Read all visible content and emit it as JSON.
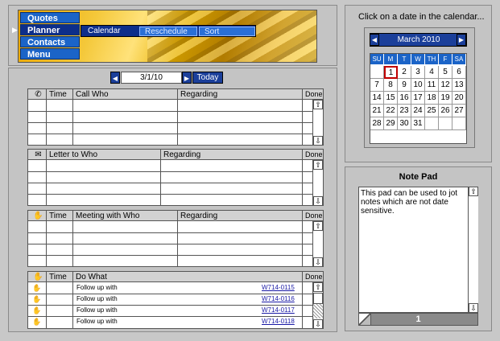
{
  "nav": {
    "items": [
      "Quotes",
      "Planner",
      "Contacts",
      "Menu"
    ],
    "sub_items": [
      "Calendar",
      "Reschedule",
      "Sort"
    ]
  },
  "datebar": {
    "date": "3/1/10",
    "today_label": "Today"
  },
  "calls": {
    "headers": [
      "Time",
      "Call Who",
      "Regarding",
      "Done"
    ]
  },
  "letters": {
    "headers": [
      "Letter to Who",
      "Regarding",
      "Done"
    ]
  },
  "meetings": {
    "headers": [
      "Time",
      "Meeting with Who",
      "Regarding",
      "Done"
    ]
  },
  "todos": {
    "headers": [
      "Time",
      "Do What",
      "Done"
    ],
    "rows": [
      {
        "text": "Follow up with",
        "link": "W714-0115"
      },
      {
        "text": "Follow up with",
        "link": "W714-0116"
      },
      {
        "text": "Follow up with",
        "link": "W714-0117"
      },
      {
        "text": "Follow up with",
        "link": "W714-0118"
      }
    ]
  },
  "calendar": {
    "instruction": "Click on a date in the calendar...",
    "month": "March 2010",
    "days_of_week": [
      "SU",
      "M",
      "T",
      "W",
      "TH",
      "F",
      "SA"
    ],
    "weeks": [
      [
        "",
        "1",
        "2",
        "3",
        "4",
        "5",
        "6"
      ],
      [
        "7",
        "8",
        "9",
        "10",
        "11",
        "12",
        "13"
      ],
      [
        "14",
        "15",
        "16",
        "17",
        "18",
        "19",
        "20"
      ],
      [
        "21",
        "22",
        "23",
        "24",
        "25",
        "26",
        "27"
      ],
      [
        "28",
        "29",
        "30",
        "31",
        "",
        "",
        ""
      ]
    ],
    "selected_day": "1"
  },
  "notepad": {
    "title": "Note Pad",
    "text": "This pad can be used to jot notes which are not date sensitive.",
    "page": "1"
  },
  "colors": {
    "nav_blue": "#1b64c8",
    "dark_blue": "#0d2e8a",
    "today_outline": "#c00000"
  }
}
